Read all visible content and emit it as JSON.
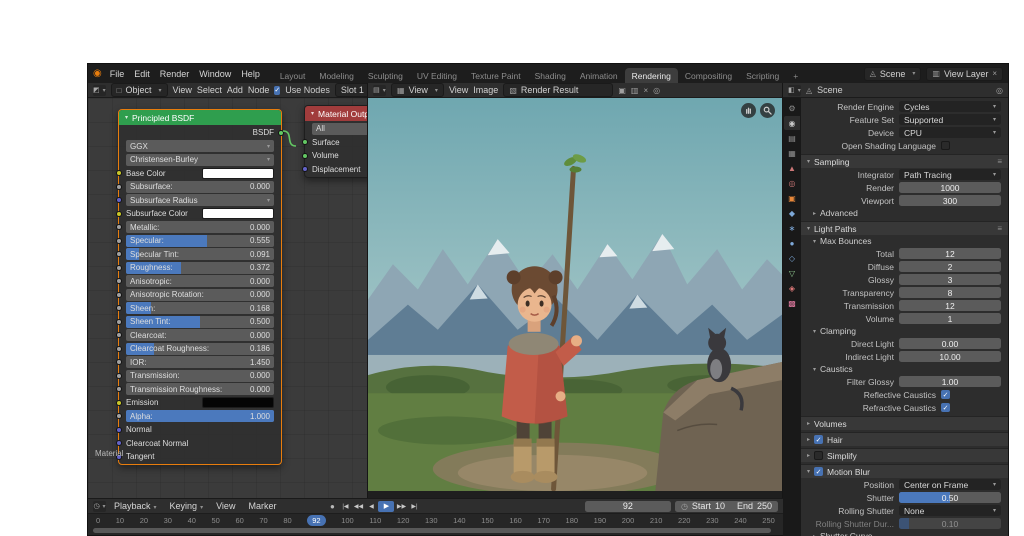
{
  "topbar": {
    "menus": [
      "File",
      "Edit",
      "Render",
      "Window",
      "Help"
    ],
    "workspaces_before": [
      "Layout",
      "Modeling",
      "Sculpting",
      "UV Editing",
      "Texture Paint",
      "Shading",
      "Animation"
    ],
    "active_workspace": "Rendering",
    "workspaces_after": [
      "Compositing",
      "Scripting",
      "+"
    ],
    "scene": "Scene",
    "view_layer": "View Layer"
  },
  "shader_editor": {
    "mode": "Object",
    "menus": [
      "View",
      "Select",
      "Add",
      "Node"
    ],
    "use_nodes_label": "Use Nodes",
    "slot_label": "Slot 1",
    "breadcrumb": "Material",
    "principled": {
      "title": "Principled BSDF",
      "output_label": "BSDF",
      "distribution": "GGX",
      "subsurface_method": "Christensen-Burley",
      "base_color_label": "Base Color",
      "subsurface": {
        "label": "Subsurface:",
        "value": "0.000",
        "fill": 0
      },
      "subsurface_radius_label": "Subsurface Radius",
      "subsurface_color_label": "Subsurface Color",
      "sliders": [
        {
          "label": "Metallic:",
          "value": "0.000",
          "fill": 0
        },
        {
          "label": "Specular:",
          "value": "0.555",
          "fill": 55
        },
        {
          "label": "Specular Tint:",
          "value": "0.091",
          "fill": 9
        },
        {
          "label": "Roughness:",
          "value": "0.372",
          "fill": 37
        },
        {
          "label": "Anisotropic:",
          "value": "0.000",
          "fill": 0
        },
        {
          "label": "Anisotropic Rotation:",
          "value": "0.000",
          "fill": 0
        },
        {
          "label": "Sheen:",
          "value": "0.168",
          "fill": 17
        },
        {
          "label": "Sheen Tint:",
          "value": "0.500",
          "fill": 50
        },
        {
          "label": "Clearcoat:",
          "value": "0.000",
          "fill": 0
        },
        {
          "label": "Clearcoat Roughness:",
          "value": "0.186",
          "fill": 19
        },
        {
          "label": "IOR:",
          "value": "1.450",
          "fill": 0
        },
        {
          "label": "Transmission:",
          "value": "0.000",
          "fill": 0
        },
        {
          "label": "Transmission Roughness:",
          "value": "0.000",
          "fill": 0
        }
      ],
      "emission_label": "Emission",
      "alpha": {
        "label": "Alpha:",
        "value": "1.000",
        "fill": 100
      },
      "vector_inputs": [
        "Normal",
        "Clearcoat Normal",
        "Tangent"
      ]
    },
    "output_node": {
      "title": "Material Output",
      "target": "All",
      "inputs": [
        "Surface",
        "Volume",
        "Displacement"
      ]
    }
  },
  "image_editor": {
    "mode_label": "View",
    "menus": [
      "View",
      "Image"
    ],
    "image_name": "Render Result"
  },
  "properties": {
    "breadcrumb": "Scene",
    "tabs": [
      {
        "name": "tool",
        "glyph": "⚙"
      },
      {
        "name": "render",
        "glyph": "◉"
      },
      {
        "name": "output",
        "glyph": "▤"
      },
      {
        "name": "view-layer",
        "glyph": "▦"
      },
      {
        "name": "scene",
        "glyph": "▲"
      },
      {
        "name": "world",
        "glyph": "◎"
      },
      {
        "name": "object",
        "glyph": "▣"
      },
      {
        "name": "modifiers",
        "glyph": "◆"
      },
      {
        "name": "particles",
        "glyph": "∗"
      },
      {
        "name": "physics",
        "glyph": "●"
      },
      {
        "name": "constraints",
        "glyph": "◇"
      },
      {
        "name": "object-data",
        "glyph": "▽"
      },
      {
        "name": "material",
        "glyph": "◈"
      },
      {
        "name": "texture",
        "glyph": "▩"
      }
    ],
    "render_engine": {
      "label": "Render Engine",
      "value": "Cycles"
    },
    "feature_set": {
      "label": "Feature Set",
      "value": "Supported"
    },
    "device": {
      "label": "Device",
      "value": "CPU"
    },
    "osl_label": "Open Shading Language",
    "sampling": {
      "title": "Sampling",
      "integrator": {
        "label": "Integrator",
        "value": "Path Tracing"
      },
      "render": {
        "label": "Render",
        "value": "1000"
      },
      "viewport": {
        "label": "Viewport",
        "value": "300"
      },
      "advanced_label": "Advanced"
    },
    "light_paths": {
      "title": "Light Paths",
      "max_bounces_title": "Max Bounces",
      "bounces": [
        {
          "label": "Total",
          "value": "12"
        },
        {
          "label": "Diffuse",
          "value": "2"
        },
        {
          "label": "Glossy",
          "value": "3"
        },
        {
          "label": "Transparency",
          "value": "8"
        },
        {
          "label": "Transmission",
          "value": "12"
        },
        {
          "label": "Volume",
          "value": "1"
        }
      ],
      "clamping_title": "Clamping",
      "direct_light": {
        "label": "Direct Light",
        "value": "0.00"
      },
      "indirect_light": {
        "label": "Indirect Light",
        "value": "10.00"
      },
      "caustics_title": "Caustics",
      "filter_glossy": {
        "label": "Filter Glossy",
        "value": "1.00"
      },
      "reflective_label": "Reflective Caustics",
      "refractive_label": "Refractive Caustics"
    },
    "volumes_title": "Volumes",
    "hair_title": "Hair",
    "simplify_title": "Simplify",
    "motion_blur": {
      "title": "Motion Blur",
      "position": {
        "label": "Position",
        "value": "Center on Frame"
      },
      "shutter": {
        "label": "Shutter",
        "value": "0.50",
        "fill": 50
      },
      "rolling_shutter": {
        "label": "Rolling Shutter",
        "value": "None"
      },
      "rolling_dur": {
        "label": "Rolling Shutter Dur...",
        "value": "0.10",
        "fill": 10
      },
      "shutter_curve_label": "Shutter Curve"
    }
  },
  "timeline": {
    "menus": [
      "Playback",
      "Keying",
      "View",
      "Marker"
    ],
    "transport": [
      "●",
      "|◀",
      "◀◀",
      "◀",
      "▶",
      "▶▶",
      "▶|"
    ],
    "current_frame": "92",
    "start": {
      "label": "Start",
      "value": "10"
    },
    "end": {
      "label": "End",
      "value": "250"
    },
    "ticks_before": [
      "0",
      "10",
      "20",
      "30",
      "40",
      "50",
      "60",
      "70",
      "80"
    ],
    "ticks_after": [
      "100",
      "110",
      "120",
      "130",
      "140",
      "150",
      "160",
      "170",
      "180",
      "190",
      "200",
      "210",
      "220",
      "230",
      "240",
      "250"
    ]
  },
  "icons": {
    "logo": "◉",
    "shader_editor": "◩",
    "object_mode": "□",
    "material_preview": "●",
    "image_editor": "▤",
    "image_view_mode": "▦",
    "render_result": "▧",
    "new_image": "▣",
    "open_image": "▥",
    "unlink": "×",
    "pin": "◎",
    "properties_editor": "◧",
    "scene": "◬",
    "view_layer": "▥",
    "remove": "×",
    "clock": "◷",
    "presets": "≡",
    "timeline_editor": "◷",
    "autokey": "●"
  },
  "colors": {
    "accent_blue": "#4772b3",
    "principled_header": "#2f9e4e",
    "output_header": "#a13c3c",
    "socket_yellow": "#c7c729",
    "socket_gray": "#a1a1a1",
    "socket_vector": "#6363c7",
    "socket_shader": "#63c763",
    "node_editor_bg": "#3b3b3b",
    "topbar_bg": "#1d1d1d"
  }
}
